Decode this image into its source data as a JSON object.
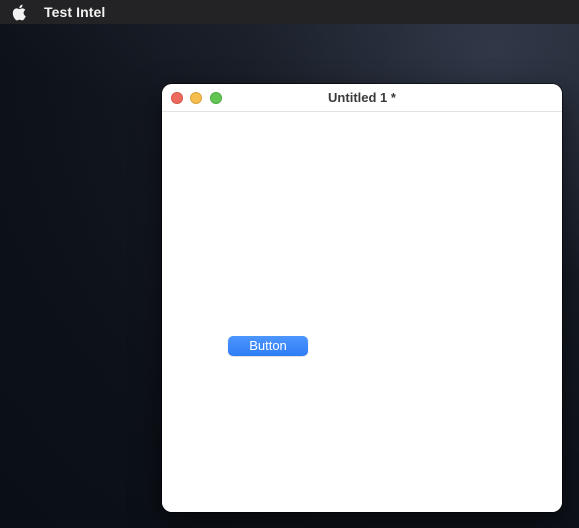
{
  "menubar": {
    "apple_icon": "apple-logo-icon",
    "app_name": "Test Intel"
  },
  "window": {
    "title": "Untitled 1 *",
    "controls": {
      "close": "close-button",
      "minimize": "minimize-button",
      "zoom": "zoom-button"
    },
    "colors": {
      "close": "#ee6a5f",
      "minimize": "#f5be4f",
      "zoom": "#62c554"
    },
    "content": {
      "button_label": "Button",
      "button_color": "#3a86f9"
    }
  }
}
